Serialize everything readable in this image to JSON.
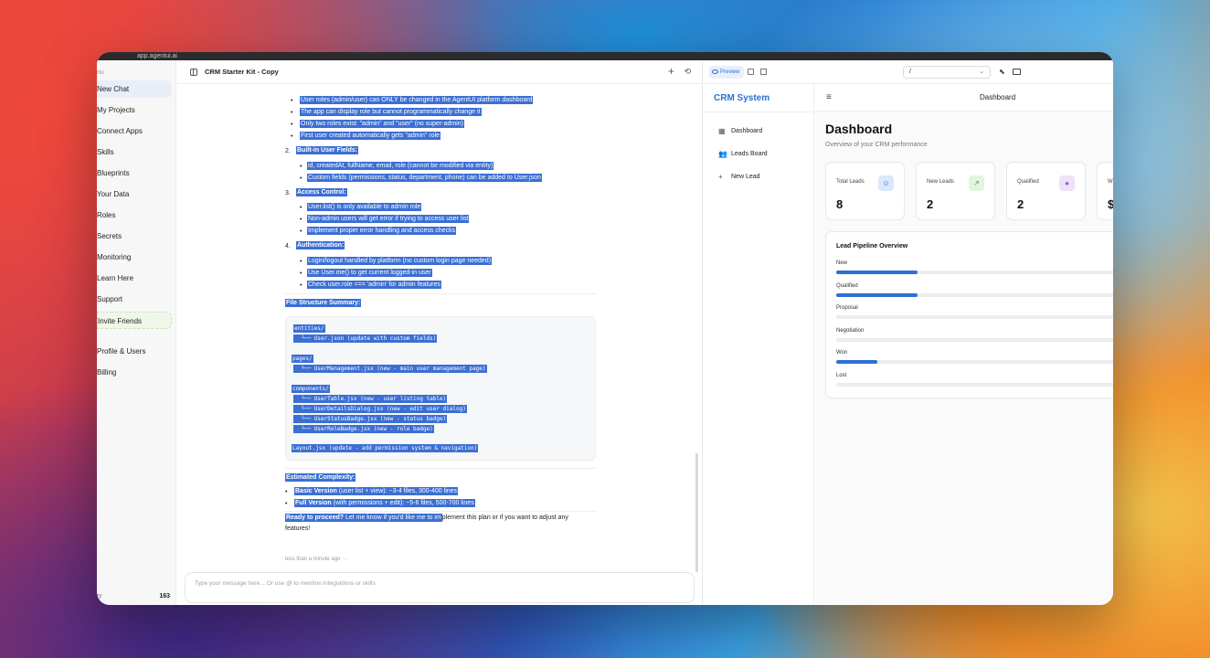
{
  "browser": {
    "url": "app.agentui.ai"
  },
  "sidebar": {
    "top_label": "nu",
    "items": [
      {
        "label": "New Chat",
        "name": "sidebar-item-new-chat"
      },
      {
        "label": "My Projects",
        "name": "sidebar-item-projects"
      },
      {
        "label": "Connect Apps",
        "name": "sidebar-item-connect-apps"
      },
      {
        "label": "Skills",
        "name": "sidebar-item-skills"
      },
      {
        "label": "Blueprints",
        "name": "sidebar-item-blueprints"
      },
      {
        "label": "Your Data",
        "name": "sidebar-item-your-data"
      },
      {
        "label": "Roles",
        "name": "sidebar-item-roles"
      },
      {
        "label": "Secrets",
        "name": "sidebar-item-secrets"
      },
      {
        "label": "Monitoring",
        "name": "sidebar-item-monitoring"
      },
      {
        "label": "Learn Here",
        "name": "sidebar-item-learn-here"
      },
      {
        "label": "Support",
        "name": "sidebar-item-support"
      },
      {
        "label": "Invite Friends",
        "name": "sidebar-item-invite-friends"
      },
      {
        "label": "Profile & Users",
        "name": "sidebar-item-profile-users"
      },
      {
        "label": "Billing",
        "name": "sidebar-item-billing"
      }
    ],
    "credits_label": "ty",
    "credits_value": "163"
  },
  "chat": {
    "title": "CRM Starter Kit - Copy",
    "roles_bullets": [
      "User roles (admin/user) can ONLY be changed in the AgentUI platform dashboard",
      "The app can display role but cannot programmatically change it",
      "Only two roles exist: \"admin\" and \"user\" (no super-admin)",
      "First user created automatically gets \"admin\" role"
    ],
    "sec2_num": "2.",
    "sec2_title": "Built-in User Fields:",
    "sec2_bullets": [
      "id, createdAt, fullName, email, role (cannot be modified via entity)",
      "Custom fields (permissions, status, department, phone) can be added to User.json"
    ],
    "sec3_num": "3.",
    "sec3_title": "Access Control:",
    "sec3_bullets": [
      "User.list() is only available to admin role",
      "Non-admin users will get error if trying to access user list",
      "Implement proper error handling and access checks"
    ],
    "sec4_num": "4.",
    "sec4_title": "Authentication:",
    "sec4_bullets": [
      "Login/logout handled by platform (no custom login page needed)",
      "Use User.me() to get current logged-in user",
      "Check user.role === 'admin' for admin features"
    ],
    "file_structure_title": "File Structure Summary:",
    "code_lines": [
      "entities/",
      "  └── User.json (update with custom fields)",
      "pages/",
      "  └── UserManagement.jsx (new - main user management page)",
      "components/",
      "  └── UserTable.jsx (new - user listing table)",
      "  └── UserDetailsDialog.jsx (new - edit user dialog)",
      "  └── UserStatusBadge.jsx (new - status badge)",
      "  └── UserRoleBadge.jsx (new - role badge)",
      "Layout.jsx (update - add permission system & navigation)"
    ],
    "complexity_title": "Estimated Complexity:",
    "complexity_items": [
      {
        "bold": "Basic Version",
        "rest": " (user list + view): ~3-4 files, 300-400 lines"
      },
      {
        "bold": "Full Version",
        "rest": " (with permissions + edit): ~5-6 files, 500-700 lines"
      }
    ],
    "proceed_bold": "Ready to proceed?",
    "proceed_hl": " Let me know if you'd like me to im",
    "proceed_rest": "plement this plan or if you want to adjust any",
    "proceed_rest2": "features!",
    "timestamp": "less than a minute ago",
    "timestamp_more": "···",
    "input_placeholder": "Type your message here... Or use @ to mention integrations or skills"
  },
  "preview": {
    "tab_label": "Preview",
    "route_value": "/",
    "crm": {
      "brand": "CRM System",
      "nav": [
        {
          "label": "Dashboard",
          "icon": "grid-icon"
        },
        {
          "label": "Leads Board",
          "icon": "users-icon"
        },
        {
          "label": "New Lead",
          "icon": "plus-icon"
        }
      ],
      "top_title": "Dashboard",
      "heading": "Dashboard",
      "subheading": "Overview of your CRM performance",
      "stats": [
        {
          "label": "Total Leads",
          "value": "8",
          "icon": "users-icon",
          "color": "#dbe8fb"
        },
        {
          "label": "New Leads",
          "value": "2",
          "icon": "trend-icon",
          "color": "#e2f4dd"
        },
        {
          "label": "Qualified",
          "value": "2",
          "icon": "circle-icon",
          "color": "#efe2f8"
        },
        {
          "label": "W",
          "value": "$",
          "icon": "",
          "color": "#ffffff"
        }
      ],
      "pipeline_title": "Lead Pipeline Overview",
      "pipeline": [
        {
          "label": "New",
          "fraction": 0.28
        },
        {
          "label": "Qualified",
          "fraction": 0.28
        },
        {
          "label": "Proposal",
          "fraction": 0
        },
        {
          "label": "Negotiation",
          "fraction": 0
        },
        {
          "label": "Won",
          "fraction": 0.14
        },
        {
          "label": "Lost",
          "fraction": 0
        }
      ],
      "accent": "#2d6fd3"
    }
  }
}
